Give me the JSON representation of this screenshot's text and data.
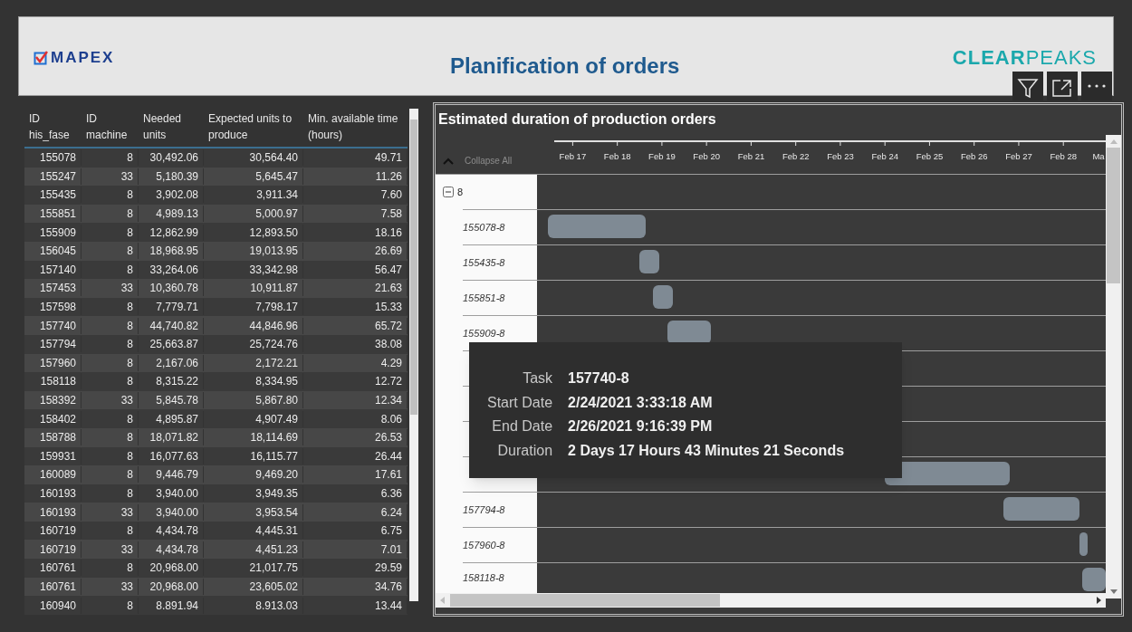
{
  "header": {
    "logo_left": "MAPEX",
    "title": "Planification of orders",
    "logo_right_strong": "CLEAR",
    "logo_right_light": "PEAKS"
  },
  "table": {
    "columns": [
      "ID his_fase",
      "ID machine",
      "Needed units",
      "Expected units to produce",
      "Min. available time (hours)"
    ],
    "rows": [
      [
        "155078",
        "8",
        "30,492.06",
        "30,564.40",
        "49.71"
      ],
      [
        "155247",
        "33",
        "5,180.39",
        "5,645.47",
        "11.26"
      ],
      [
        "155435",
        "8",
        "3,902.08",
        "3,911.34",
        "7.60"
      ],
      [
        "155851",
        "8",
        "4,989.13",
        "5,000.97",
        "7.58"
      ],
      [
        "155909",
        "8",
        "12,862.99",
        "12,893.50",
        "18.16"
      ],
      [
        "156045",
        "8",
        "18,968.95",
        "19,013.95",
        "26.69"
      ],
      [
        "157140",
        "8",
        "33,264.06",
        "33,342.98",
        "56.47"
      ],
      [
        "157453",
        "33",
        "10,360.78",
        "10,911.87",
        "21.63"
      ],
      [
        "157598",
        "8",
        "7,779.71",
        "7,798.17",
        "15.33"
      ],
      [
        "157740",
        "8",
        "44,740.82",
        "44,846.96",
        "65.72"
      ],
      [
        "157794",
        "8",
        "25,663.87",
        "25,724.76",
        "38.08"
      ],
      [
        "157960",
        "8",
        "2,167.06",
        "2,172.21",
        "4.29"
      ],
      [
        "158118",
        "8",
        "8,315.22",
        "8,334.95",
        "12.72"
      ],
      [
        "158392",
        "33",
        "5,845.78",
        "5,867.80",
        "12.34"
      ],
      [
        "158402",
        "8",
        "4,895.87",
        "4,907.49",
        "8.06"
      ],
      [
        "158788",
        "8",
        "18,071.82",
        "18,114.69",
        "26.53"
      ],
      [
        "159931",
        "8",
        "16,077.63",
        "16,115.77",
        "26.44"
      ],
      [
        "160089",
        "8",
        "9,446.79",
        "9,469.20",
        "17.61"
      ],
      [
        "160193",
        "8",
        "3,940.00",
        "3,949.35",
        "6.36"
      ],
      [
        "160193",
        "33",
        "3,940.00",
        "3,953.54",
        "6.24"
      ],
      [
        "160719",
        "8",
        "4,434.78",
        "4,445.31",
        "6.75"
      ],
      [
        "160719",
        "33",
        "4,434.78",
        "4,451.23",
        "7.01"
      ],
      [
        "160761",
        "8",
        "20,968.00",
        "21,017.75",
        "29.59"
      ],
      [
        "160761",
        "33",
        "20,968.00",
        "23,605.02",
        "34.76"
      ],
      [
        "160940",
        "8",
        "8.891.94",
        "8.913.03",
        "13.44"
      ]
    ]
  },
  "gantt": {
    "title": "Estimated duration of production orders",
    "collapse_label": "Collapse All",
    "group": {
      "label": "8",
      "expanded": true
    },
    "axis_labels": [
      "Feb 17",
      "Feb 18",
      "Feb 19",
      "Feb 20",
      "Feb 21",
      "Feb 22",
      "Feb 23",
      "Feb 24",
      "Feb 25",
      "Feb 26",
      "Feb 27",
      "Feb 28",
      "Ma"
    ],
    "tasks_above_tooltip": [
      "155078-8",
      "155435-8",
      "155851-8",
      "155909-8"
    ],
    "tasks_below_tooltip": [
      "157794-8",
      "157960-8",
      "158118-8"
    ]
  },
  "tooltip": {
    "rows": [
      {
        "label": "Task",
        "value": "157740-8"
      },
      {
        "label": "Start Date",
        "value": "2/24/2021 3:33:18 AM"
      },
      {
        "label": "End Date",
        "value": "2/26/2021 9:16:39 PM"
      },
      {
        "label": "Duration",
        "value": "2 Days 17 Hours 43 Minutes 21 Seconds"
      }
    ]
  }
}
